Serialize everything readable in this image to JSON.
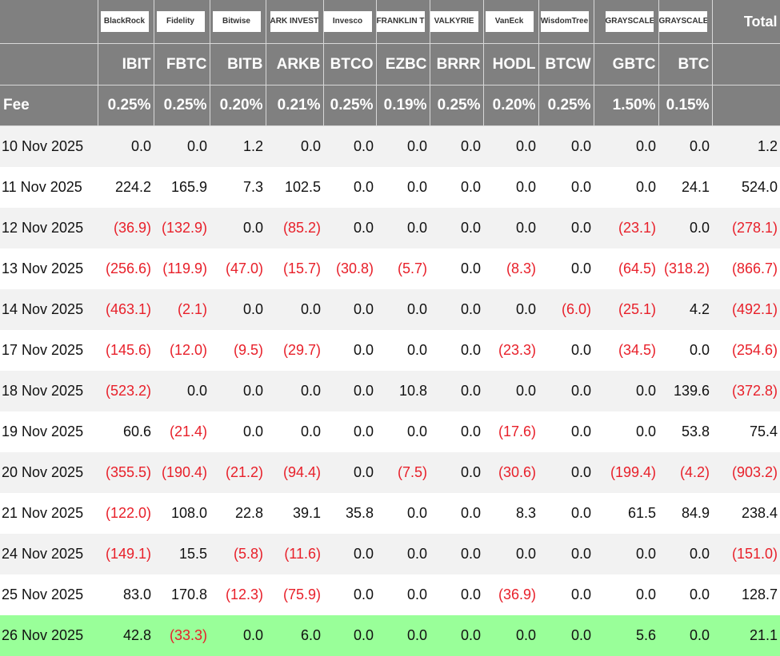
{
  "header": {
    "logos": [
      "BlackRock",
      "Fidelity",
      "Bitwise",
      "ARK INVEST",
      "Invesco",
      "FRANKLIN TEMPLETON",
      "VALKYRIE",
      "VanEck",
      "WisdomTree",
      "GRAYSCALE",
      "GRAYSCALE"
    ],
    "total_label": "Total",
    "tickers": [
      "IBIT",
      "FBTC",
      "BITB",
      "ARKB",
      "BTCO",
      "EZBC",
      "BRRR",
      "HODL",
      "BTCW",
      "GBTC",
      "BTC"
    ],
    "fee_label": "Fee",
    "fees": [
      "0.25%",
      "0.25%",
      "0.20%",
      "0.21%",
      "0.25%",
      "0.19%",
      "0.25%",
      "0.20%",
      "0.25%",
      "1.50%",
      "0.15%"
    ]
  },
  "colors": {
    "header_bg": "#808080",
    "negative": "#e8202a",
    "latest_row": "#99ff99",
    "alt_row": "#f2f2f2"
  },
  "rows": [
    {
      "date": "10 Nov 2025",
      "values": [
        "0.0",
        "0.0",
        "1.2",
        "0.0",
        "0.0",
        "0.0",
        "0.0",
        "0.0",
        "0.0",
        "0.0",
        "0.0"
      ],
      "total": "1.2"
    },
    {
      "date": "11 Nov 2025",
      "values": [
        "224.2",
        "165.9",
        "7.3",
        "102.5",
        "0.0",
        "0.0",
        "0.0",
        "0.0",
        "0.0",
        "0.0",
        "24.1"
      ],
      "total": "524.0"
    },
    {
      "date": "12 Nov 2025",
      "values": [
        "(36.9)",
        "(132.9)",
        "0.0",
        "(85.2)",
        "0.0",
        "0.0",
        "0.0",
        "0.0",
        "0.0",
        "(23.1)",
        "0.0"
      ],
      "total": "(278.1)"
    },
    {
      "date": "13 Nov 2025",
      "values": [
        "(256.6)",
        "(119.9)",
        "(47.0)",
        "(15.7)",
        "(30.8)",
        "(5.7)",
        "0.0",
        "(8.3)",
        "0.0",
        "(64.5)",
        "(318.2)"
      ],
      "total": "(866.7)"
    },
    {
      "date": "14 Nov 2025",
      "values": [
        "(463.1)",
        "(2.1)",
        "0.0",
        "0.0",
        "0.0",
        "0.0",
        "0.0",
        "0.0",
        "(6.0)",
        "(25.1)",
        "4.2"
      ],
      "total": "(492.1)"
    },
    {
      "date": "17 Nov 2025",
      "values": [
        "(145.6)",
        "(12.0)",
        "(9.5)",
        "(29.7)",
        "0.0",
        "0.0",
        "0.0",
        "(23.3)",
        "0.0",
        "(34.5)",
        "0.0"
      ],
      "total": "(254.6)"
    },
    {
      "date": "18 Nov 2025",
      "values": [
        "(523.2)",
        "0.0",
        "0.0",
        "0.0",
        "0.0",
        "10.8",
        "0.0",
        "0.0",
        "0.0",
        "0.0",
        "139.6"
      ],
      "total": "(372.8)"
    },
    {
      "date": "19 Nov 2025",
      "values": [
        "60.6",
        "(21.4)",
        "0.0",
        "0.0",
        "0.0",
        "0.0",
        "0.0",
        "(17.6)",
        "0.0",
        "0.0",
        "53.8"
      ],
      "total": "75.4"
    },
    {
      "date": "20 Nov 2025",
      "values": [
        "(355.5)",
        "(190.4)",
        "(21.2)",
        "(94.4)",
        "0.0",
        "(7.5)",
        "0.0",
        "(30.6)",
        "0.0",
        "(199.4)",
        "(4.2)"
      ],
      "total": "(903.2)"
    },
    {
      "date": "21 Nov 2025",
      "values": [
        "(122.0)",
        "108.0",
        "22.8",
        "39.1",
        "35.8",
        "0.0",
        "0.0",
        "8.3",
        "0.0",
        "61.5",
        "84.9"
      ],
      "total": "238.4"
    },
    {
      "date": "24 Nov 2025",
      "values": [
        "(149.1)",
        "15.5",
        "(5.8)",
        "(11.6)",
        "0.0",
        "0.0",
        "0.0",
        "0.0",
        "0.0",
        "0.0",
        "0.0"
      ],
      "total": "(151.0)"
    },
    {
      "date": "25 Nov 2025",
      "values": [
        "83.0",
        "170.8",
        "(12.3)",
        "(75.9)",
        "0.0",
        "0.0",
        "0.0",
        "(36.9)",
        "0.0",
        "0.0",
        "0.0"
      ],
      "total": "128.7"
    },
    {
      "date": "26 Nov 2025",
      "values": [
        "42.8",
        "(33.3)",
        "0.0",
        "6.0",
        "0.0",
        "0.0",
        "0.0",
        "0.0",
        "0.0",
        "5.6",
        "0.0"
      ],
      "total": "21.1",
      "latest": true
    }
  ]
}
